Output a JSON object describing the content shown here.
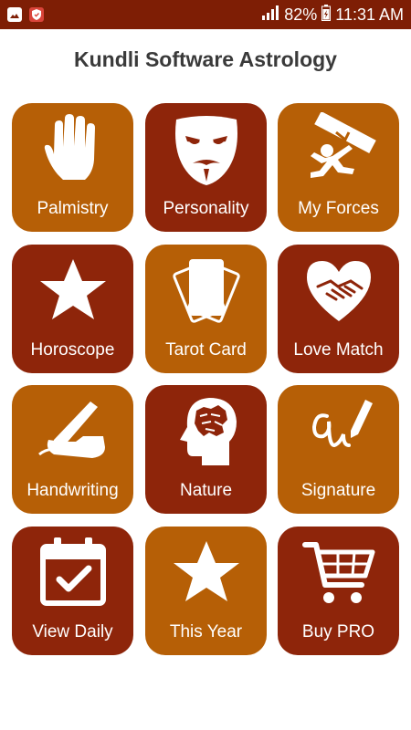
{
  "status_bar": {
    "battery": "82%",
    "time": "11:31 AM",
    "icons": [
      "gallery-icon",
      "shield-icon",
      "signal-icon",
      "battery-icon"
    ]
  },
  "header": {
    "title": "Kundli Software Astrology"
  },
  "colors": {
    "status_bar": "#7e1e05",
    "tile_light": "#b65f06",
    "tile_dark": "#8e250a",
    "icon": "#ffffff"
  },
  "tiles": [
    {
      "label": "Palmistry",
      "icon": "hand-icon",
      "color": "#b65f06"
    },
    {
      "label": "Personality",
      "icon": "mask-icon",
      "color": "#8e250a"
    },
    {
      "label": "My Forces",
      "icon": "lifting-man-icon",
      "color": "#b65f06"
    },
    {
      "label": "Horoscope",
      "icon": "star-icon",
      "color": "#8e250a"
    },
    {
      "label": "Tarot Card",
      "icon": "cards-icon",
      "color": "#b65f06"
    },
    {
      "label": "Love Match",
      "icon": "heart-handshake-icon",
      "color": "#8e250a"
    },
    {
      "label": "Handwriting",
      "icon": "pen-hand-icon",
      "color": "#b65f06"
    },
    {
      "label": "Nature",
      "icon": "brain-head-icon",
      "color": "#8e250a"
    },
    {
      "label": "Signature",
      "icon": "signature-icon",
      "color": "#b65f06"
    },
    {
      "label": "View Daily",
      "icon": "calendar-check-icon",
      "color": "#8e250a"
    },
    {
      "label": "This Year",
      "icon": "star-icon",
      "color": "#b65f06"
    },
    {
      "label": "Buy PRO",
      "icon": "cart-icon",
      "color": "#8e250a"
    }
  ]
}
